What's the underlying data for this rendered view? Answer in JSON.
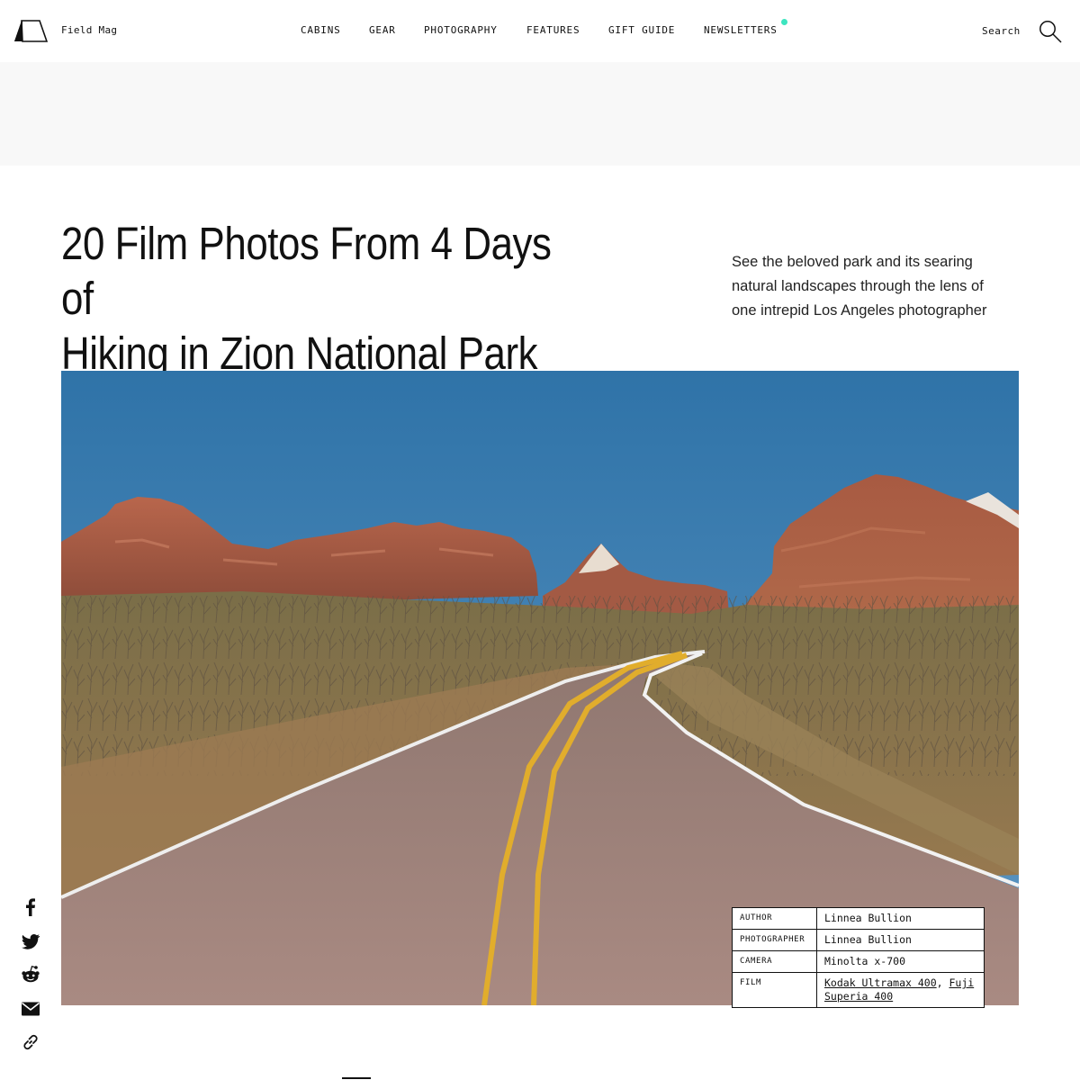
{
  "header": {
    "brand": "Field Mag",
    "nav": [
      {
        "label": "CABINS"
      },
      {
        "label": "GEAR"
      },
      {
        "label": "PHOTOGRAPHY"
      },
      {
        "label": "FEATURES"
      },
      {
        "label": "GIFT GUIDE"
      },
      {
        "label": "NEWSLETTERS"
      }
    ],
    "search_label": "Search",
    "accent_dot_color": "#3de5c0"
  },
  "article": {
    "title_line1": "20 Film Photos From 4 Days of",
    "title_line2": "Hiking in Zion National Park",
    "dek_line1": "See the beloved park and its searing",
    "dek_line2": "natural landscapes through the lens of",
    "dek_line3": "one intrepid Los Angeles photographer"
  },
  "credits": {
    "author_label": "AUTHOR",
    "author": "Linnea Bullion",
    "photographer_label": "PHOTOGRAPHER",
    "photographer": "Linnea Bullion",
    "camera_label": "CAMERA",
    "camera": "Minolta x-700",
    "film_label": "FILM",
    "film_1": "Kodak Ultramax 400",
    "film_sep": ", ",
    "film_2": "Fuji Superia 400"
  },
  "share": {
    "icons": [
      "facebook-icon",
      "twitter-icon",
      "reddit-icon",
      "email-icon",
      "link-icon"
    ]
  }
}
